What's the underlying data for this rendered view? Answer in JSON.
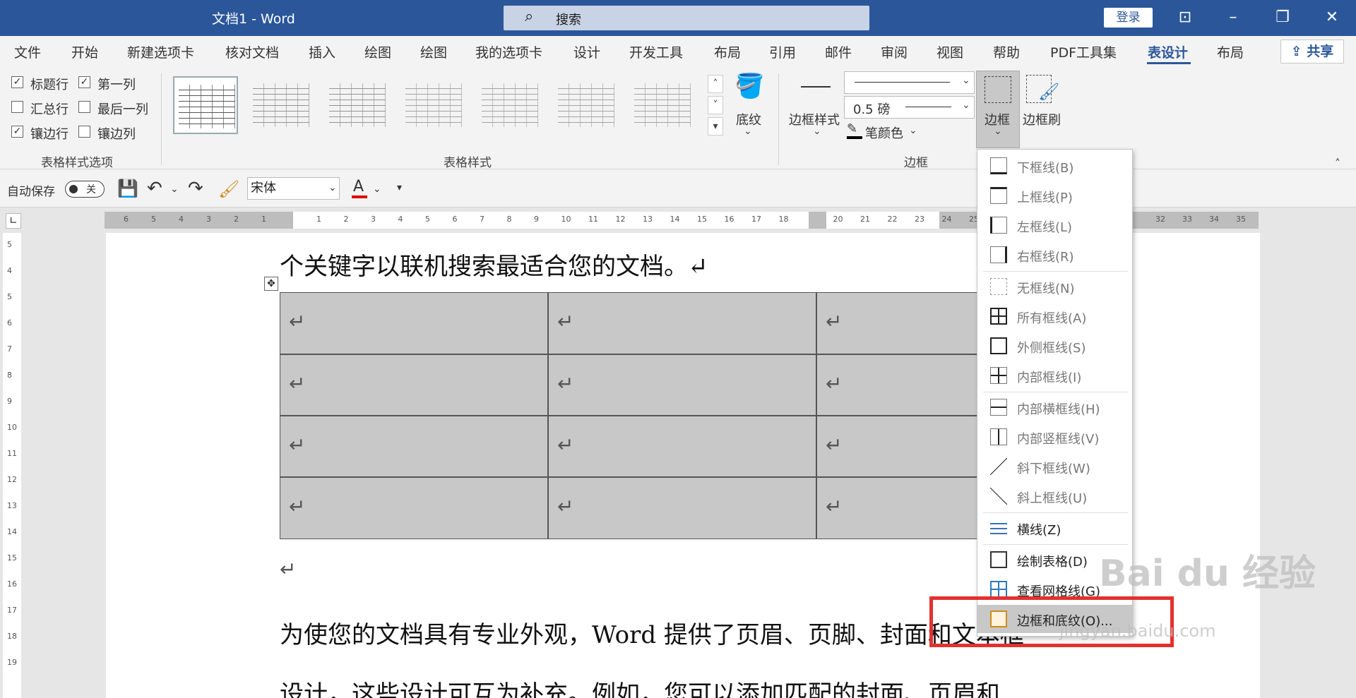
{
  "window": {
    "title": "文档1  -  Word",
    "search_placeholder": "搜索",
    "login": "登录",
    "share": "共享"
  },
  "tabs": [
    "文件",
    "开始",
    "新建选项卡",
    "核对文档",
    "插入",
    "绘图",
    "绘图",
    "我的选项卡",
    "设计",
    "开发工具",
    "布局",
    "引用",
    "邮件",
    "审阅",
    "视图",
    "帮助",
    "PDF工具集",
    "表设计",
    "布局"
  ],
  "active_tab": "表设计",
  "ribbon": {
    "style_options": {
      "title": "表格样式选项",
      "items": [
        {
          "label": "标题行",
          "checked": true
        },
        {
          "label": "第一列",
          "checked": true
        },
        {
          "label": "汇总行",
          "checked": false
        },
        {
          "label": "最后一列",
          "checked": false
        },
        {
          "label": "镶边行",
          "checked": true
        },
        {
          "label": "镶边列",
          "checked": false
        }
      ]
    },
    "table_styles": {
      "title": "表格样式"
    },
    "shading": "底纹",
    "borders": {
      "title": "边框",
      "border_style": "边框样式",
      "weight": "0.5 磅",
      "pen_color": "笔颜色",
      "border_btn": "边框",
      "painter": "边框刷"
    }
  },
  "qat": {
    "autosave": "自动保存",
    "autosave_state": "关",
    "font": "宋体",
    "font_color_glyph": "A"
  },
  "ruler": {
    "left_nums": [
      "6",
      "5",
      "4",
      "3",
      "2",
      "1"
    ],
    "right_nums": [
      "1",
      "2",
      "3",
      "4",
      "5",
      "6",
      "7",
      "8",
      "9",
      "10",
      "11",
      "12",
      "13",
      "14",
      "15",
      "16",
      "17",
      "18",
      "",
      "20",
      "21",
      "22",
      "23",
      "24",
      "25"
    ],
    "far_nums": [
      "32",
      "33",
      "34",
      "35"
    ],
    "vertical_nums": [
      "5",
      "4",
      "5",
      "6",
      "7",
      "8",
      "9",
      "10",
      "11",
      "12",
      "13",
      "14",
      "15",
      "16",
      "17",
      "18",
      "19"
    ]
  },
  "document": {
    "line1": "个关键字以联机搜索最适合您的文档。↵",
    "para_mark": "↵",
    "line2": "为使您的文档具有专业外观，Word 提供了页眉、页脚、封面和文本框",
    "line3": "设计，这些设计可互为补充。例如，您可以添加匹配的封面、页眉和"
  },
  "dropdown": {
    "items": [
      {
        "label": "下框线(B)",
        "icon": "border-bottom-icon"
      },
      {
        "label": "上框线(P)",
        "icon": "border-top-icon"
      },
      {
        "label": "左框线(L)",
        "icon": "border-left-icon"
      },
      {
        "label": "右框线(R)",
        "icon": "border-right-icon"
      },
      {
        "label": "无框线(N)",
        "icon": "border-none-icon"
      },
      {
        "label": "所有框线(A)",
        "icon": "border-all-icon"
      },
      {
        "label": "外侧框线(S)",
        "icon": "border-outside-icon"
      },
      {
        "label": "内部框线(I)",
        "icon": "border-inside-icon"
      },
      {
        "label": "内部横框线(H)",
        "icon": "border-inside-horizontal-icon"
      },
      {
        "label": "内部竖框线(V)",
        "icon": "border-inside-vertical-icon"
      },
      {
        "label": "斜下框线(W)",
        "icon": "diagonal-down-icon"
      },
      {
        "label": "斜上框线(U)",
        "icon": "diagonal-up-icon"
      },
      {
        "label": "横线(Z)",
        "icon": "horizontal-line-icon"
      },
      {
        "label": "绘制表格(D)",
        "icon": "draw-table-icon"
      },
      {
        "label": "查看网格线(G)",
        "icon": "view-gridlines-icon"
      },
      {
        "label": "边框和底纹(O)...",
        "icon": "borders-shading-icon"
      }
    ]
  },
  "watermark": {
    "brand": "Bai du 经验",
    "url": "jingyan.baidu.com"
  }
}
